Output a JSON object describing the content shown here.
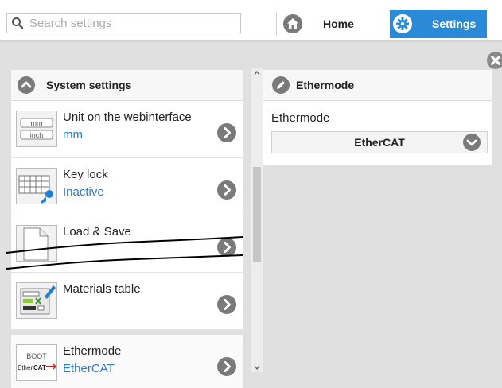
{
  "search": {
    "placeholder": "Search settings"
  },
  "nav": {
    "home_label": "Home",
    "settings_label": "Settings",
    "active": "Settings"
  },
  "colors": {
    "accent": "#2b8ad7",
    "value_text": "#2a7ac4",
    "icon_gray": "#7a7a7a"
  },
  "left_panel": {
    "title": "System settings",
    "items": [
      {
        "name": "Unit on the webinterface",
        "value": "mm",
        "thumb": "unit-thumb",
        "thumb_labels": [
          "mm",
          "inch"
        ]
      },
      {
        "name": "Key lock",
        "value": "Inactive",
        "thumb": "keyboard-key-thumb"
      },
      {
        "name": "Load & Save",
        "value": "",
        "thumb": "document-thumb"
      },
      {
        "name": "Materials table",
        "value": "",
        "thumb": "materials-thumb"
      },
      {
        "name": "Ethermode",
        "value": "EtherCAT",
        "thumb": "ethermode-thumb",
        "thumb_labels": [
          "BOOT",
          "Ether",
          "CAT"
        ]
      }
    ]
  },
  "right_panel": {
    "title": "Ethermode",
    "field_label": "Ethermode",
    "field_value": "EtherCAT"
  }
}
